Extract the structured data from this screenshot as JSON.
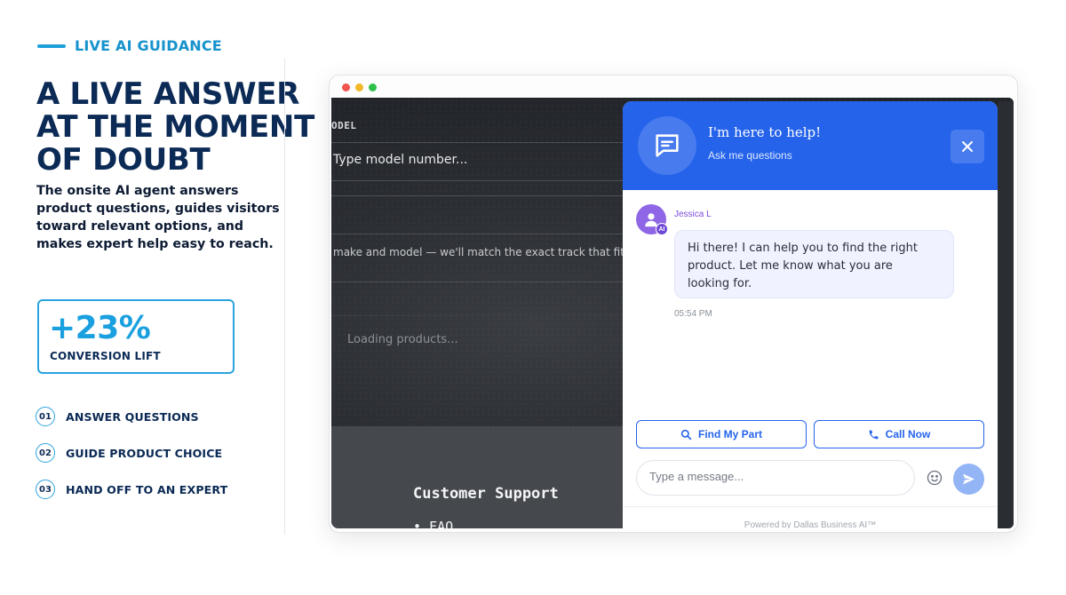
{
  "left": {
    "eyebrow": "LIVE AI GUIDANCE",
    "headline": "A LIVE ANSWER AT THE MOMENT OF DOUBT",
    "subtext": "The onsite AI agent answers product questions, guides visitors toward relevant options, and makes expert help easy to reach.",
    "stat": {
      "value": "+23%",
      "label": "CONVERSION LIFT"
    },
    "steps": [
      {
        "num": "01",
        "text": "ANSWER QUESTIONS"
      },
      {
        "num": "02",
        "text": "GUIDE PRODUCT CHOICE"
      },
      {
        "num": "03",
        "text": "HAND OFF TO AN EXPERT"
      }
    ]
  },
  "site": {
    "model_label": "ODEL",
    "model_placeholder": "Type model number...",
    "help_text": "make and model — we'll match the exact track that fits",
    "loading": "Loading products...",
    "footer_title": "Customer Support",
    "footer_link": "• FAQ"
  },
  "chat": {
    "title": "I'm here to help!",
    "subtitle": "Ask me questions",
    "agent_name": "Jessica L",
    "agent_badge": "AI",
    "message_lines": [
      "Hi there! I can help you to find the right",
      "product. Let me know what you are",
      "looking for."
    ],
    "time": "05:54 PM",
    "quick_actions": [
      {
        "label": "Find My Part",
        "icon": "search-icon"
      },
      {
        "label": "Call Now",
        "icon": "phone-icon"
      }
    ],
    "input_placeholder": "Type a message...",
    "powered_by": "Powered by Dallas Business AI™"
  },
  "colors": {
    "accent": "#1ea0d9",
    "navy": "#0b2a55",
    "chat_blue": "#2563eb",
    "agent_purple": "#8f67e6"
  }
}
